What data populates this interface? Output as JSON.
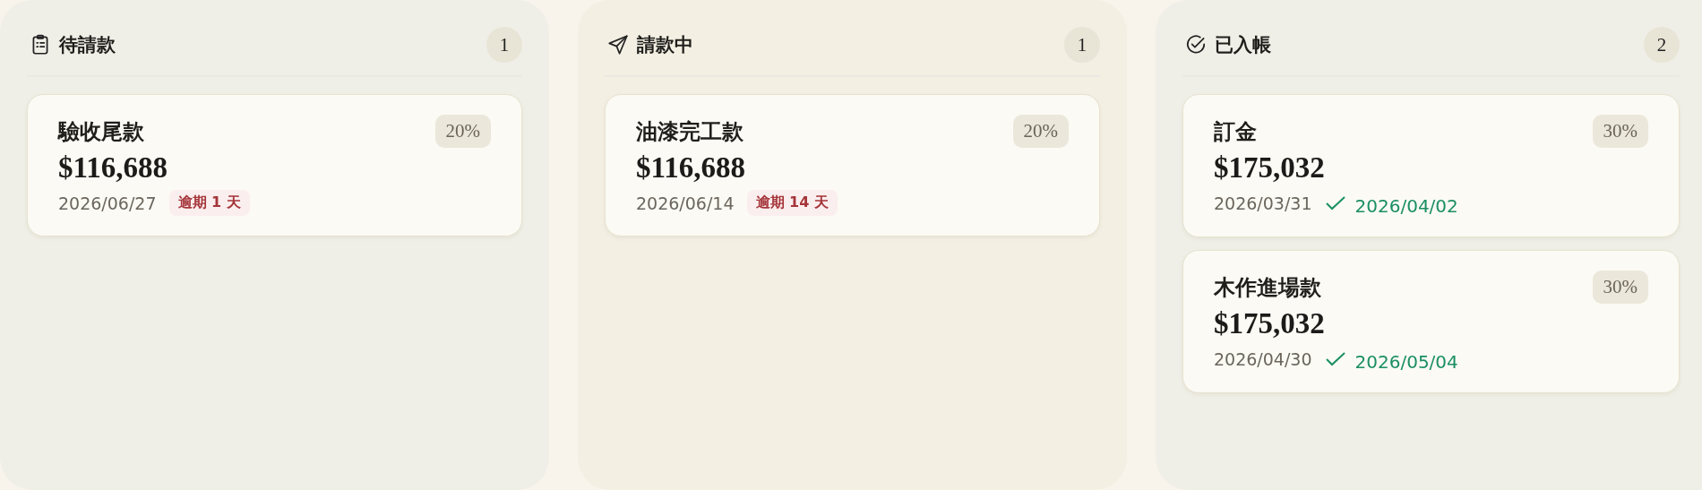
{
  "columns": [
    {
      "title": "待請款",
      "kind": "pending",
      "count": "1",
      "cards": [
        {
          "title": "驗收尾款",
          "percent": "20%",
          "amount": "$116,688",
          "due_date": "2026/06/27",
          "kind": "overdue",
          "overdue": "逾期 1 天"
        }
      ]
    },
    {
      "title": "請款中",
      "kind": "requested",
      "count": "1",
      "cards": [
        {
          "title": "油漆完工款",
          "percent": "20%",
          "amount": "$116,688",
          "due_date": "2026/06/14",
          "kind": "overdue",
          "overdue": "逾期 14 天"
        }
      ]
    },
    {
      "title": "已入帳",
      "kind": "received",
      "count": "2",
      "cards": [
        {
          "title": "訂金",
          "percent": "30%",
          "amount": "$175,032",
          "due_date": "2026/03/31",
          "kind": "paid",
          "paid_date": "2026/04/02"
        },
        {
          "title": "木作進場款",
          "percent": "30%",
          "amount": "$175,032",
          "due_date": "2026/04/30",
          "kind": "paid",
          "paid_date": "2026/05/04"
        }
      ]
    }
  ]
}
